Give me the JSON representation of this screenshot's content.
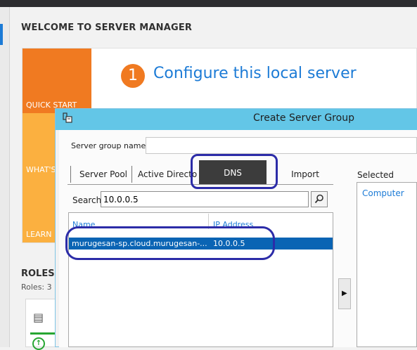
{
  "server_manager": {
    "welcome_title": "WELCOME TO SERVER MANAGER",
    "tiles": {
      "quick_start": "QUICK START",
      "whats_new": "WHAT'S",
      "learn_more": "LEARN"
    },
    "step_number": "1",
    "step_text": "Configure this local server",
    "roles_heading": "ROLES A",
    "roles_count": "Roles: 3"
  },
  "dialog": {
    "title": "Create Server Group",
    "group_name_label": "Server group name",
    "group_name_value": "",
    "tabs": [
      {
        "label": "Server Pool",
        "active": false
      },
      {
        "label": "Active Directory",
        "active": false
      },
      {
        "label": "DNS",
        "active": true
      },
      {
        "label": "Import",
        "active": false
      }
    ],
    "search": {
      "label": "Search:",
      "value": "10.0.0.5"
    },
    "columns": {
      "name": "Name",
      "ip": "IP Address"
    },
    "results": [
      {
        "name": "murugesan-sp.cloud.murugesan-...",
        "ip": "10.0.0.5",
        "selected": true
      }
    ],
    "add_arrow": "▶",
    "selected_label": "Selected",
    "selected_column": "Computer"
  },
  "colors": {
    "accent_blue": "#1c7bd6",
    "quick_start_orange": "#f07a21",
    "tile_amber": "#fbb040",
    "dialog_titlebar": "#63c6e7",
    "selection_blue": "#0a64b4",
    "annotation_ring": "#2c2ca8"
  },
  "icons": {
    "dialog_icon": "server-group-icon",
    "search_button": "magnifier-icon",
    "roles_card": "server-roles-icon",
    "roles_status": "up-arrow-circle-icon"
  }
}
